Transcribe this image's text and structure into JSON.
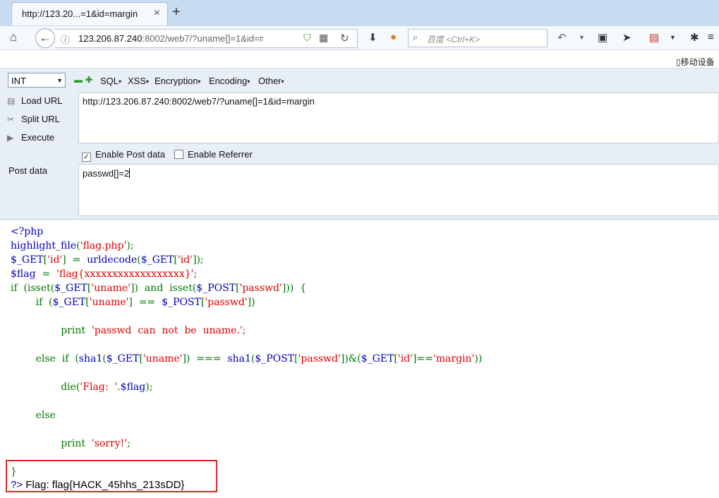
{
  "browser": {
    "tab_title": "http://123.20...=1&id=margin",
    "tab_close": "×",
    "new_tab": "+",
    "url_host": "123.206.87.240",
    "url_rest": ":8002/web7/?uname[]=1&id=margi",
    "search_placeholder": "百度 <Ctrl+K>",
    "device_mode_label": "移动设备"
  },
  "hackbar": {
    "select_value": "INT",
    "menus": [
      "SQL",
      "XSS",
      "Encryption",
      "Encoding",
      "Other"
    ],
    "load_url": "Load URL",
    "split_url": "Split URL",
    "execute": "Execute",
    "url_value": "http://123.206.87.240:8002/web7/?uname[]=1&id=margin",
    "enable_post": "Enable Post data",
    "enable_post_checked": true,
    "enable_referrer": "Enable Referrer",
    "enable_referrer_checked": false,
    "post_label": "Post data",
    "post_value": "passwd[]=2"
  },
  "code": {
    "lines": [
      [
        [
          "d",
          "<?php"
        ]
      ],
      [
        [
          "d",
          "highlight_file"
        ],
        [
          "k",
          "("
        ],
        [
          "s",
          "'flag.php'"
        ],
        [
          "k",
          ");"
        ]
      ],
      [
        [
          "d",
          "$_GET"
        ],
        [
          "k",
          "["
        ],
        [
          "s",
          "'id'"
        ],
        [
          "k",
          "]  =  "
        ],
        [
          "d",
          "urldecode"
        ],
        [
          "k",
          "("
        ],
        [
          "d",
          "$_GET"
        ],
        [
          "k",
          "["
        ],
        [
          "s",
          "'id'"
        ],
        [
          "k",
          "]);"
        ]
      ],
      [
        [
          "d",
          "$flag  "
        ],
        [
          "k",
          "=  "
        ],
        [
          "s",
          "'flag{xxxxxxxxxxxxxxxxxx}'"
        ],
        [
          "k",
          ";"
        ]
      ],
      [
        [
          "k",
          "if  (isset("
        ],
        [
          "d",
          "$_GET"
        ],
        [
          "k",
          "["
        ],
        [
          "s",
          "'uname'"
        ],
        [
          "k",
          "])  and  isset("
        ],
        [
          "d",
          "$_POST"
        ],
        [
          "k",
          "["
        ],
        [
          "s",
          "'passwd'"
        ],
        [
          "k",
          "]))  {"
        ]
      ],
      [
        [
          "k",
          "        if  ("
        ],
        [
          "d",
          "$_GET"
        ],
        [
          "k",
          "["
        ],
        [
          "s",
          "'uname'"
        ],
        [
          "k",
          "]  ==  "
        ],
        [
          "d",
          "$_POST"
        ],
        [
          "k",
          "["
        ],
        [
          "s",
          "'passwd'"
        ],
        [
          "k",
          "])"
        ]
      ],
      [],
      [
        [
          "k",
          "                print  "
        ],
        [
          "s",
          "'passwd  can  not  be  uname.'"
        ],
        [
          "k",
          ";"
        ]
      ],
      [],
      [
        [
          "k",
          "        else  if  ("
        ],
        [
          "d",
          "sha1"
        ],
        [
          "k",
          "("
        ],
        [
          "d",
          "$_GET"
        ],
        [
          "k",
          "["
        ],
        [
          "s",
          "'uname'"
        ],
        [
          "k",
          "])  ===  "
        ],
        [
          "d",
          "sha1"
        ],
        [
          "k",
          "("
        ],
        [
          "d",
          "$_POST"
        ],
        [
          "k",
          "["
        ],
        [
          "s",
          "'passwd'"
        ],
        [
          "k",
          "])&("
        ],
        [
          "d",
          "$_GET"
        ],
        [
          "k",
          "["
        ],
        [
          "s",
          "'id'"
        ],
        [
          "k",
          "]=="
        ],
        [
          "s",
          "'margin'"
        ],
        [
          "k",
          "))"
        ]
      ],
      [],
      [
        [
          "k",
          "                die("
        ],
        [
          "s",
          "'Flag:  '"
        ],
        [
          "k",
          "."
        ],
        [
          "d",
          "$flag"
        ],
        [
          "k",
          ");"
        ]
      ],
      [],
      [
        [
          "k",
          "        else"
        ]
      ],
      [],
      [
        [
          "k",
          "                print  "
        ],
        [
          "s",
          "'sorry!'"
        ],
        [
          "k",
          ";"
        ]
      ],
      [],
      [
        [
          "k",
          "}"
        ]
      ]
    ],
    "close_tag": "?>",
    "result_text": " Flag: flag{HACK_45hhs_213sDD}"
  },
  "colors": {
    "php_default": "#0000BB",
    "php_keyword": "#007700",
    "php_string": "#DD0000",
    "highlight_border": "#e0262b"
  }
}
